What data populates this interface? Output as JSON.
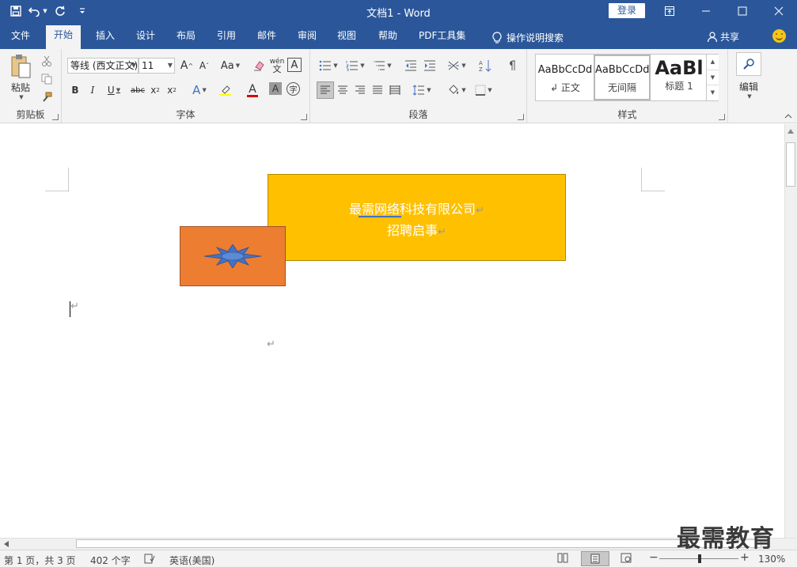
{
  "window": {
    "title": "文档1 - Word",
    "login_label": "登录"
  },
  "tabs": [
    {
      "label": "文件"
    },
    {
      "label": "开始"
    },
    {
      "label": "插入"
    },
    {
      "label": "设计"
    },
    {
      "label": "布局"
    },
    {
      "label": "引用"
    },
    {
      "label": "邮件"
    },
    {
      "label": "审阅"
    },
    {
      "label": "视图"
    },
    {
      "label": "帮助"
    },
    {
      "label": "PDF工具集"
    },
    {
      "label": "操作说明搜索"
    }
  ],
  "share_label": "共享",
  "ribbon": {
    "clipboard": {
      "paste_label": "粘贴",
      "group_label": "剪贴板"
    },
    "font": {
      "font_name": "等线 (西文正文)",
      "font_size": "11",
      "group_label": "字体",
      "change_case": "Aa"
    },
    "paragraph": {
      "group_label": "段落"
    },
    "styles": {
      "group_label": "样式",
      "items": [
        {
          "sample": "AaBbCcDd",
          "name": "↲ 正文"
        },
        {
          "sample": "AaBbCcDd",
          "name": "无间隔"
        },
        {
          "sample": "AaBl",
          "name": "标题 1"
        }
      ]
    },
    "editing": {
      "label": "编辑"
    }
  },
  "document": {
    "shape1_line1": "最需网络科技有限公司",
    "shape1_line2": "招聘启事",
    "paragraph_mark": "↵"
  },
  "status": {
    "page": "第 1 页，共 3 页",
    "words": "402 个字",
    "language": "英语(美国)",
    "zoom": "130%"
  },
  "watermark": "最需教育",
  "colors": {
    "brand": "#2b579a",
    "shape1_fill": "#ffc000",
    "shape2_fill": "#ed7d31",
    "star_fill": "#4472c4"
  }
}
